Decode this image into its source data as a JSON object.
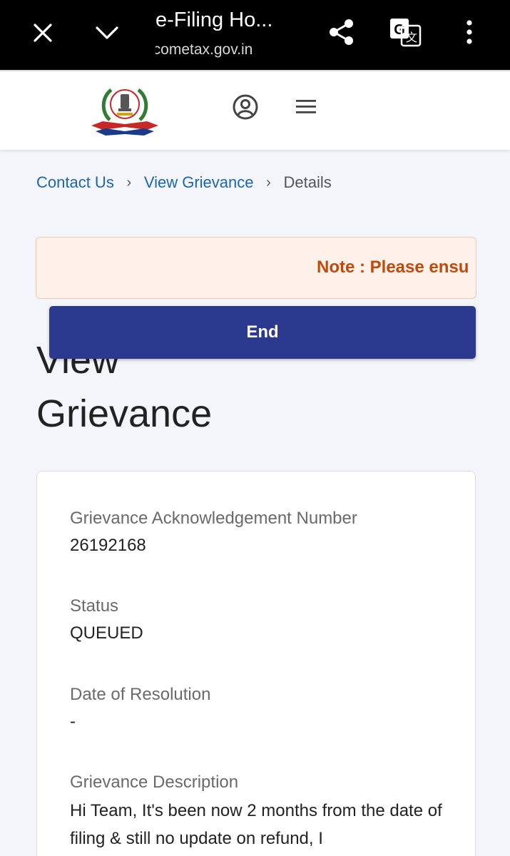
{
  "browser": {
    "page_title": "e-Filing Ho...",
    "url": "icometax.gov.in",
    "icons": {
      "close": "close-icon",
      "collapse": "chevron-down-icon",
      "share": "share-icon",
      "translate": "translate-icon",
      "menu": "more-vert-icon"
    }
  },
  "header": {
    "logo_text": "INCOME TAX DEPARTMENT",
    "icons": {
      "user": "user-circle-icon",
      "menu": "hamburger-icon"
    }
  },
  "breadcrumb": {
    "items": [
      "Contact Us",
      "View Grievance",
      "Details"
    ],
    "separator": "›"
  },
  "note": {
    "text": "Note : Please ensu"
  },
  "end_button": {
    "label": "End"
  },
  "page_heading": {
    "line1": "View",
    "line2": "Grievance"
  },
  "details": {
    "ack_label": "Grievance Acknowledgement Number",
    "ack_value": "26192168",
    "status_label": "Status",
    "status_value": "QUEUED",
    "resolution_label": "Date of Resolution",
    "resolution_value": "-",
    "description_label": "Grievance Description",
    "description_value": "Hi Team, It's been now 2 months from the date of filing & still no update on refund, I"
  },
  "colors": {
    "link": "#1a66b3",
    "note_text": "#c04a0c",
    "note_bg": "#fdf1ea",
    "button_bg": "#2b3a8f",
    "page_bg": "#f4f5fa"
  }
}
